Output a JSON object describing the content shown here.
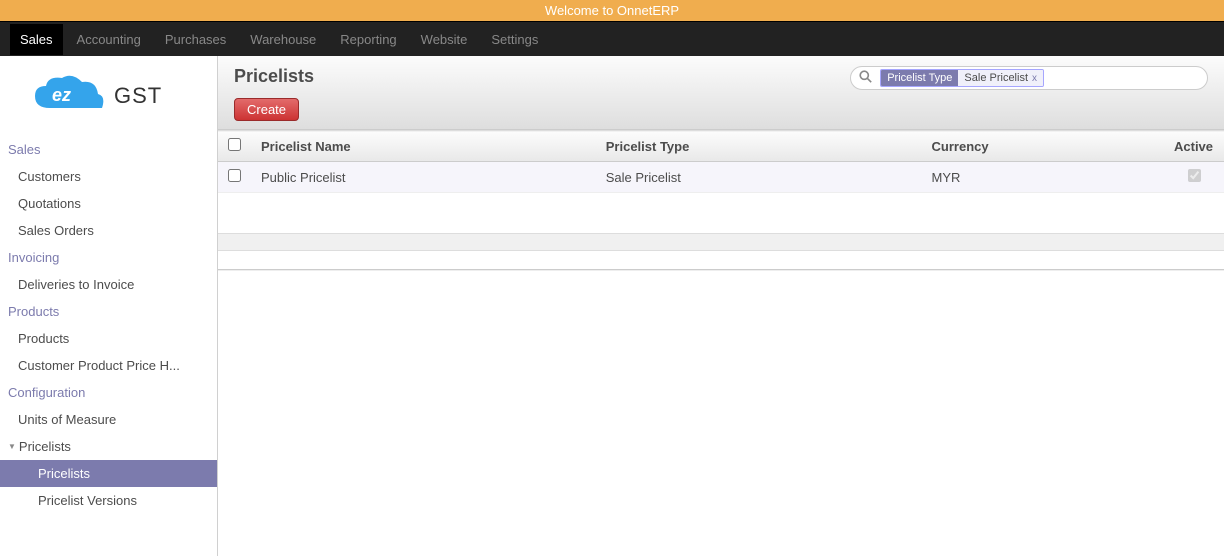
{
  "banner": {
    "text": "Welcome to OnnetERP"
  },
  "topnav": {
    "items": [
      {
        "label": "Sales",
        "active": true
      },
      {
        "label": "Accounting"
      },
      {
        "label": "Purchases"
      },
      {
        "label": "Warehouse"
      },
      {
        "label": "Reporting"
      },
      {
        "label": "Website"
      },
      {
        "label": "Settings"
      }
    ]
  },
  "logo": {
    "brand_text": "GST"
  },
  "sidebar": {
    "sections": [
      {
        "title": "Sales",
        "items": [
          "Customers",
          "Quotations",
          "Sales Orders"
        ]
      },
      {
        "title": "Invoicing",
        "items": [
          "Deliveries to Invoice"
        ]
      },
      {
        "title": "Products",
        "items": [
          "Products",
          "Customer Product Price H..."
        ]
      },
      {
        "title": "Configuration",
        "items": [
          "Units of Measure"
        ],
        "parents": [
          {
            "label": "Pricelists",
            "expanded": true,
            "children": [
              {
                "label": "Pricelists",
                "active": true
              },
              {
                "label": "Pricelist Versions"
              }
            ]
          }
        ]
      }
    ]
  },
  "page": {
    "title": "Pricelists",
    "create_label": "Create"
  },
  "search": {
    "facet_category": "Pricelist Type",
    "facet_value": "Sale Pricelist",
    "facet_close": "x",
    "placeholder": ""
  },
  "table": {
    "columns": {
      "name": "Pricelist Name",
      "type": "Pricelist Type",
      "currency": "Currency",
      "active": "Active"
    },
    "rows": [
      {
        "name": "Public Pricelist",
        "type": "Sale Pricelist",
        "currency": "MYR",
        "active": true
      }
    ]
  }
}
